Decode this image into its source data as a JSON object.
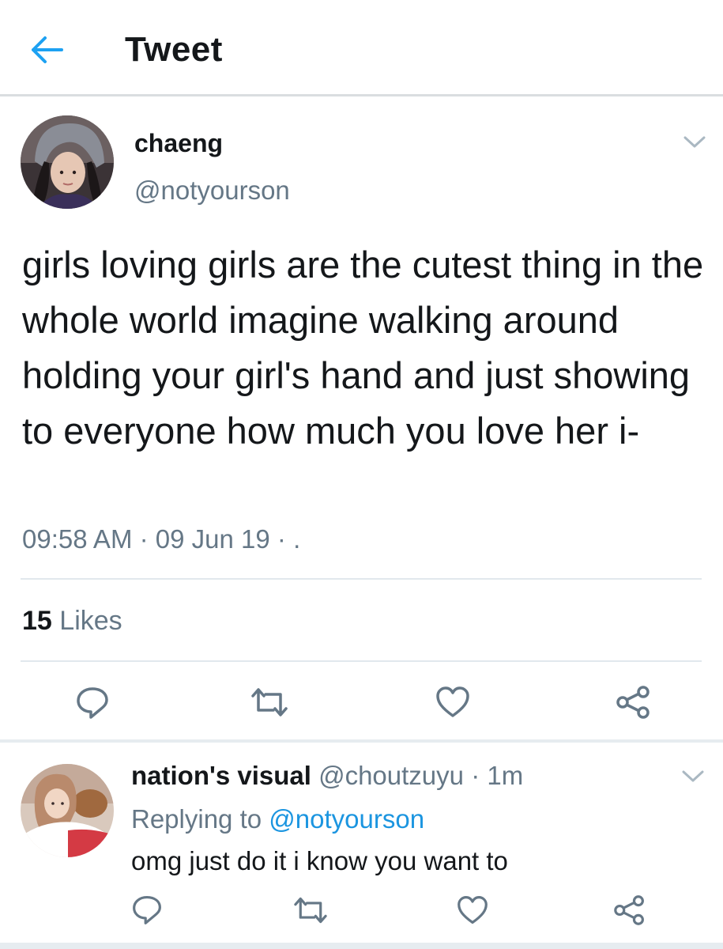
{
  "header": {
    "title": "Tweet"
  },
  "tweet": {
    "author_name": "chaeng",
    "author_handle": "@notyourson",
    "text": "girls loving girls are the cutest thing in the whole world imagine walking around holding your girl's hand and just showing to everyone how much you love her i-",
    "time": "09:58 AM",
    "date": "09 Jun 19",
    "meta_tail": "·  .",
    "likes_count": "15",
    "likes_label": "Likes"
  },
  "reply": {
    "author_name": "nation's visual",
    "author_handle": "@choutzuyu",
    "age": "1m",
    "replying_label": "Replying to",
    "replying_to": "@notyourson",
    "text": "omg just do it i know you want to"
  },
  "icons": [
    "back-arrow-icon",
    "chevron-down-icon",
    "reply-icon",
    "retweet-icon",
    "like-icon",
    "share-icon"
  ],
  "colors": {
    "accent": "#1da1f2",
    "muted": "#657786",
    "text": "#14171a",
    "icon": "#657786"
  }
}
